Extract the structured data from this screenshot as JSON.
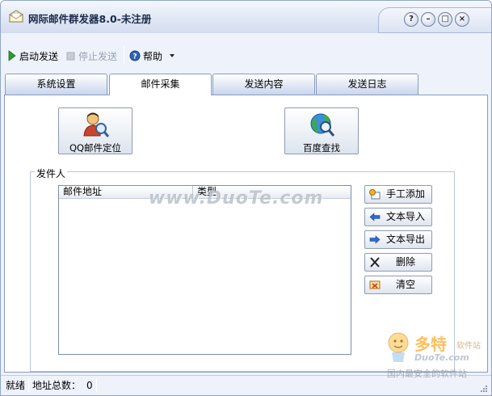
{
  "window": {
    "title": "网际邮件群发器8.0-未注册",
    "controls": [
      "?",
      "–",
      "□",
      "×"
    ]
  },
  "toolbar": {
    "start_label": "启动发送",
    "stop_label": "停止发送",
    "help_label": "帮助"
  },
  "tabs": [
    {
      "label": "系统设置",
      "active": false
    },
    {
      "label": "邮件采集",
      "active": true
    },
    {
      "label": "发送内容",
      "active": false
    },
    {
      "label": "发送日志",
      "active": false
    }
  ],
  "collect": {
    "qq_button_label": "QQ邮件定位",
    "baidu_button_label": "百度查找"
  },
  "sender_group": {
    "title": "发件人",
    "columns": [
      "邮件地址",
      "类型"
    ],
    "rows": [],
    "buttons": {
      "manual_add": "手工添加",
      "import_text": "文本导入",
      "export_text": "文本导出",
      "delete": "删除",
      "clear": "清空"
    }
  },
  "watermark": {
    "text": "www.DuoTe.com",
    "logo_big": "多特",
    "logo_small": "软件站",
    "logo_site": "DuoTe.com",
    "logo_slogan": "国内最安全的软件站"
  },
  "status": {
    "state": "就绪",
    "count_label": "地址总数：",
    "count_value": "0"
  },
  "colors": {
    "accent": "#8fa6c8",
    "play_green": "#2f9a2f",
    "watermark_orange": "#ffaa28"
  }
}
